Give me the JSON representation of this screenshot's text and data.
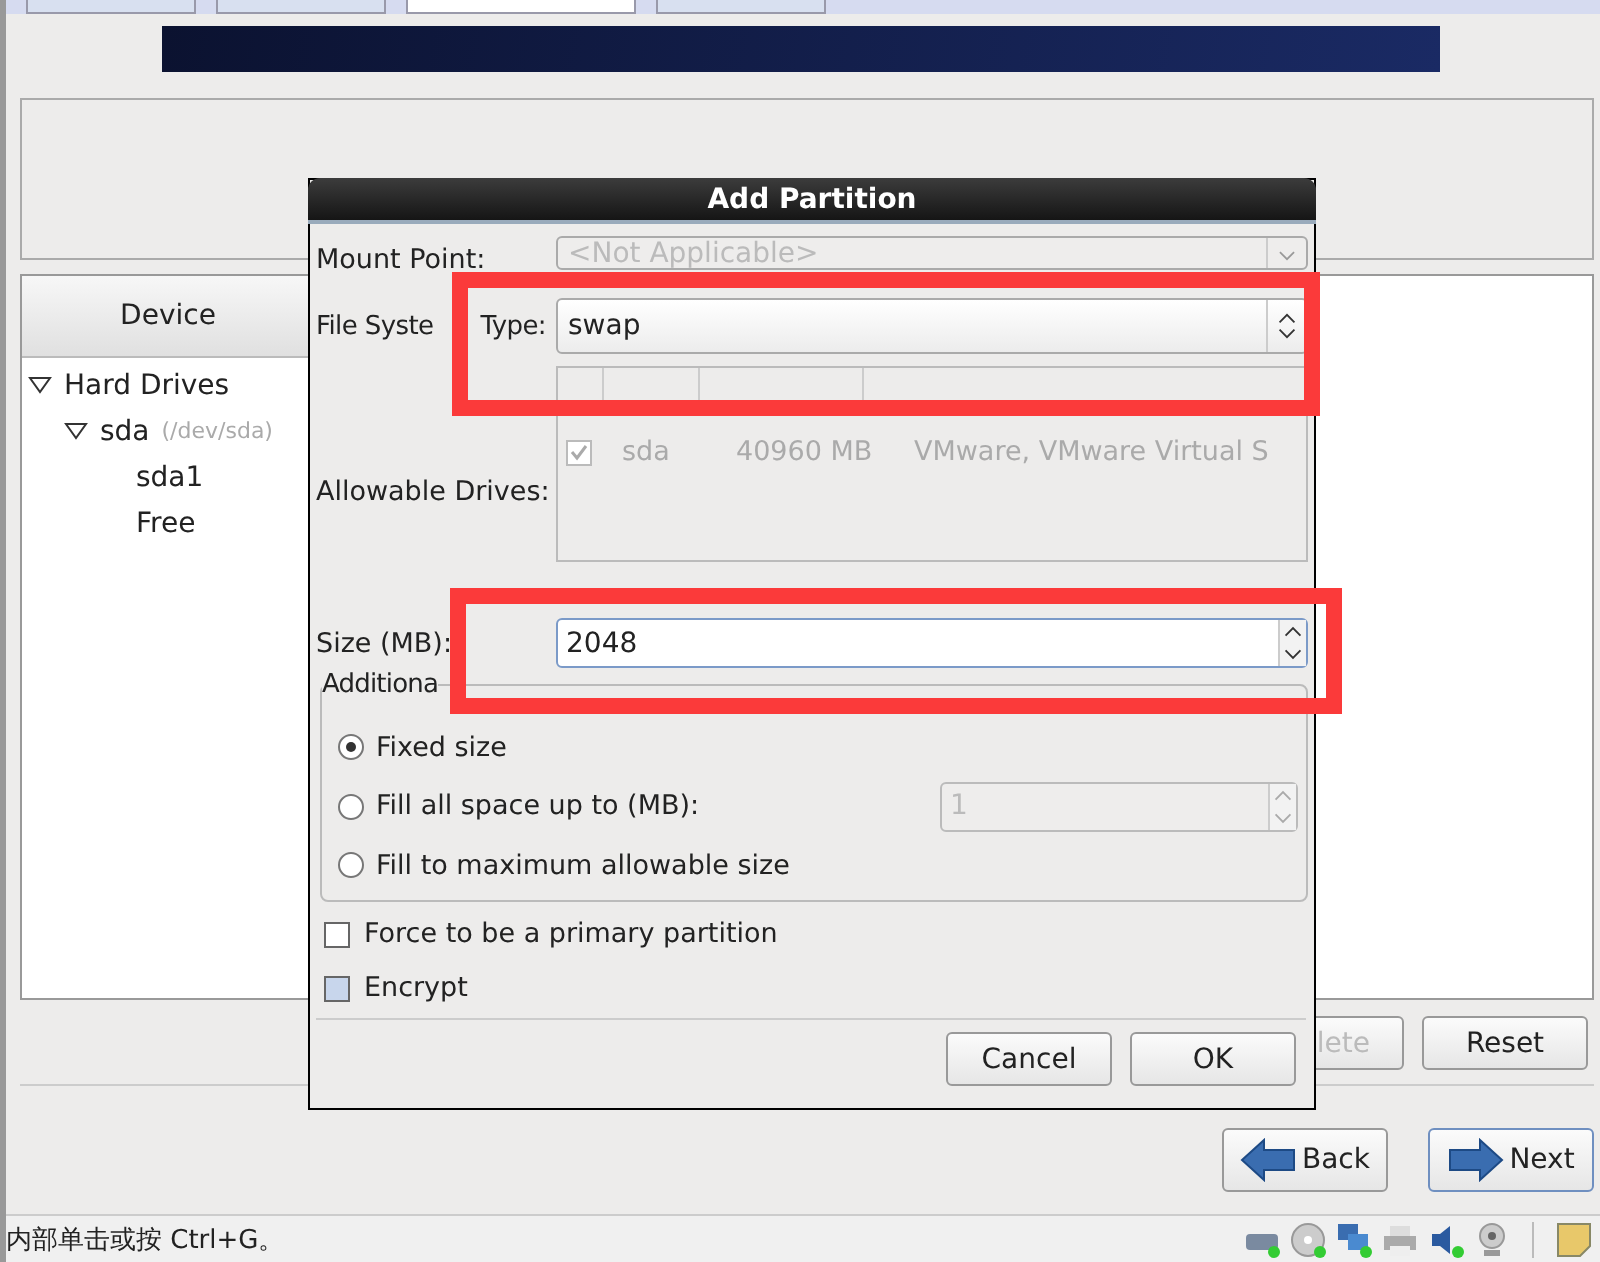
{
  "top_tabs": [
    {
      "selected": false
    },
    {
      "selected": false
    },
    {
      "selected": true
    },
    {
      "selected": false
    }
  ],
  "device_table": {
    "columns": [
      "Device"
    ],
    "tree": [
      {
        "label": "Hard Drives",
        "expanded": true,
        "children": [
          {
            "label": "sda",
            "detail": "(/dev/sda)",
            "expanded": true,
            "children": [
              {
                "label": "sda1"
              },
              {
                "label": "Free"
              }
            ]
          }
        ]
      }
    ]
  },
  "partition_buttons": [
    {
      "label": "lete",
      "disabled": true
    },
    {
      "label": "Reset",
      "disabled": false
    }
  ],
  "nav_buttons": [
    {
      "label": "Back",
      "kind": "back",
      "focused": false
    },
    {
      "label": "Next",
      "kind": "next",
      "focused": true
    }
  ],
  "status_bar": {
    "text": "内部单击或按 Ctrl+G。"
  },
  "dialog": {
    "title": "Add Partition",
    "mount_point": {
      "label": "Mount Point:",
      "value": "<Not Applicable>",
      "disabled": true
    },
    "fs_type": {
      "label_parts": [
        "File Syste",
        "Type:"
      ],
      "value": "swap"
    },
    "drives": {
      "label": "Allowable Drives:",
      "disabled": true,
      "rows": [
        {
          "checked": true,
          "drive": "sda",
          "size": "40960 MB",
          "model": "VMware, VMware Virtual S"
        }
      ]
    },
    "size": {
      "label": "Size (MB):",
      "value": "2048"
    },
    "size_options": {
      "legend": "Additiona",
      "options": [
        {
          "label": "Fixed size",
          "selected": true
        },
        {
          "label": "Fill all space up to (MB):",
          "selected": false,
          "spin_value": "1"
        },
        {
          "label": "Fill to maximum allowable size",
          "selected": false
        }
      ]
    },
    "checkboxes": [
      {
        "label": "Force to be a primary partition",
        "checked": false,
        "hover": false
      },
      {
        "label": "Encrypt",
        "checked": false,
        "hover": true
      }
    ],
    "buttons": [
      "Cancel",
      "OK"
    ]
  },
  "annotations": [
    {
      "kind": "highlight"
    },
    {
      "kind": "highlight"
    }
  ]
}
